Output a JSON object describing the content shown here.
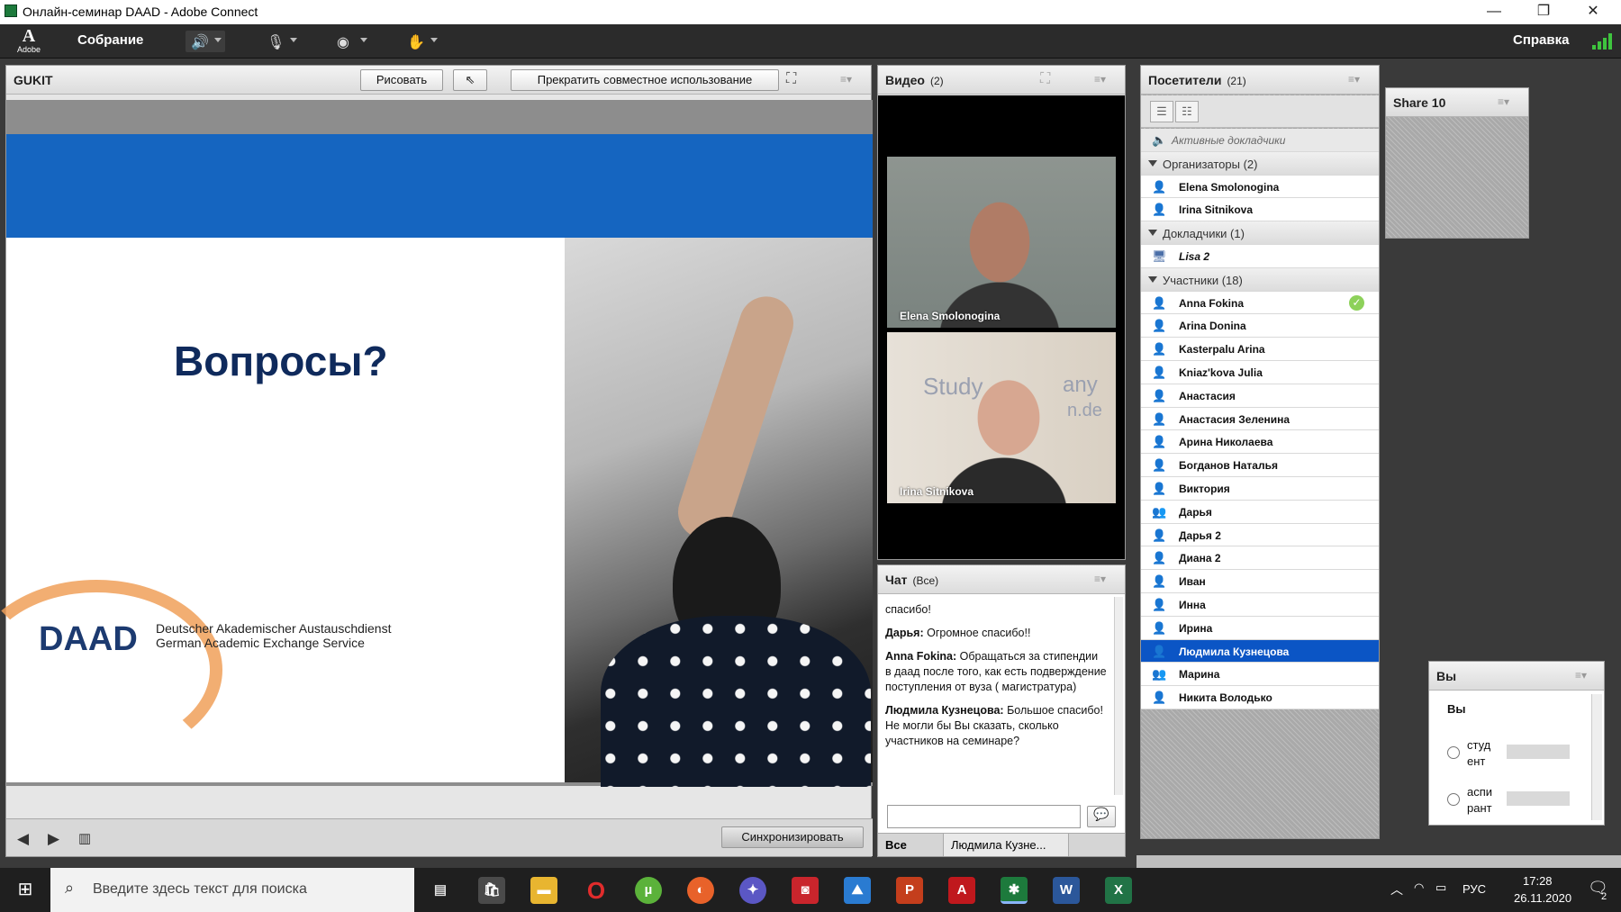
{
  "window": {
    "title": "Онлайн-семинар DAAD - Adobe Connect"
  },
  "toolbar": {
    "meeting_menu": "Собрание",
    "help_menu": "Справка",
    "adobe_label": "Adobe"
  },
  "share_pod": {
    "title": "GUKIT",
    "draw_button": "Рисовать",
    "stop_share_button": "Прекратить совместное использование",
    "sync_button": "Синхронизировать",
    "slide": {
      "heading": "Вопросы?",
      "logo": "DAAD",
      "org_line1": "Deutscher Akademischer Austauschdienst",
      "org_line2": "German Academic Exchange Service"
    }
  },
  "video_pod": {
    "title": "Видео",
    "count": "(2)",
    "tiles": [
      {
        "name": "Elena Smolonogina"
      },
      {
        "name": "Irina Sitnikova",
        "bg_text1": "Study",
        "bg_text2": "any",
        "bg_text3": "n.de"
      }
    ]
  },
  "chat_pod": {
    "title": "Чат",
    "scope": "(Все)",
    "messages": [
      {
        "author": "",
        "text": "спасибо!"
      },
      {
        "author": "Дарья:",
        "text": " Огромное спасибо!!"
      },
      {
        "author": "Anna Fokina:",
        "text": " Обращаться за стипендии в даад после того, как есть подверждение поступления от вуза ( магистратура)"
      },
      {
        "author": "Людмила Кузнецова:",
        "text": " Большое спасибо! Не могли бы Вы сказать, сколько участников на семинаре?"
      }
    ],
    "input_placeholder": "",
    "tabs": [
      "Все",
      "Людмила Кузне..."
    ]
  },
  "attendees_pod": {
    "title": "Посетители",
    "count": "(21)",
    "active_speakers": "Активные докладчики",
    "groups": [
      {
        "label": "Организаторы (2)",
        "people": [
          "Elena Smolonogina",
          "Irina Sitnikova"
        ]
      },
      {
        "label": "Докладчики (1)",
        "people": [
          "Lisa 2"
        ]
      },
      {
        "label": "Участники (18)",
        "people": [
          "Anna Fokina",
          "Arina Donina",
          "Kasterpalu Arina",
          "Kniaz'kova Julia",
          "Анастасия",
          "Анастасия Зеленина",
          "Арина Николаева",
          "Богданов Наталья",
          "Виктория",
          "Дарья",
          "Дарья 2",
          "Диана 2",
          "Иван",
          "Инна",
          "Ирина",
          "Людмила Кузнецова",
          "Марина",
          "Никита Володько"
        ]
      }
    ],
    "selected": "Людмила Кузнецова"
  },
  "share10_pod": {
    "title": "Share 10"
  },
  "poll_pod": {
    "title": "Вы",
    "question": "Вы",
    "options": [
      {
        "label": "студ ент"
      },
      {
        "label": "аспи рант"
      }
    ]
  },
  "taskbar": {
    "search_placeholder": "Введите здесь текст для поиска",
    "language": "РУС",
    "time": "17:28",
    "date": "26.11.2020",
    "notifications": "2"
  },
  "colors": {
    "accent": "#1565c0",
    "selected_row": "#0b55c5",
    "toolbar": "#2b2b2b"
  }
}
